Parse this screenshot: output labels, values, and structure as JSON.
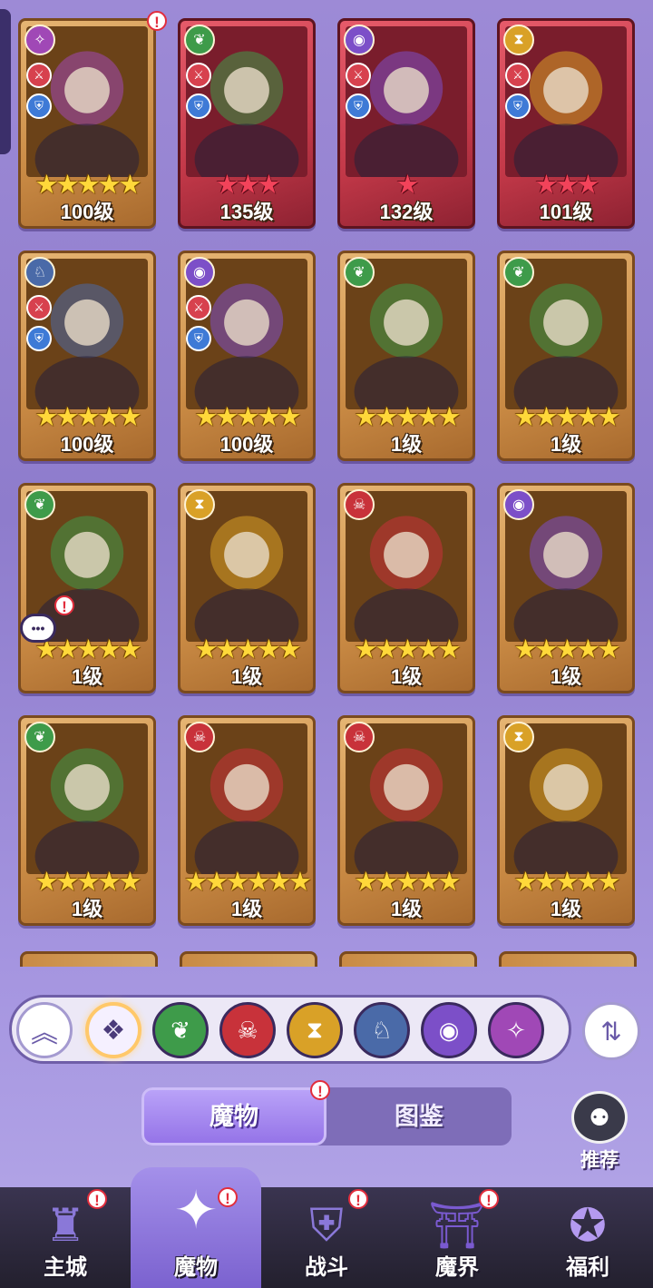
{
  "colors": {
    "forest": "#3e9b4a",
    "demon": "#c8323a",
    "time": "#d9a127",
    "beast": "#4a6aa8",
    "eye": "#7c4fc8",
    "chaos": "#a048b6"
  },
  "cards": [
    {
      "level": "100级",
      "stars": 5,
      "star_color": "gold",
      "frame": "gold",
      "faction": "chaos",
      "faction_icon": "✧",
      "roles": true,
      "alert": true
    },
    {
      "level": "135级",
      "stars": 3,
      "star_color": "red",
      "frame": "red",
      "faction": "forest",
      "faction_icon": "❦",
      "roles": true,
      "alert": false
    },
    {
      "level": "132级",
      "stars": 1,
      "star_color": "red",
      "frame": "red",
      "faction": "eye",
      "faction_icon": "◉",
      "roles": true,
      "alert": false
    },
    {
      "level": "101级",
      "stars": 3,
      "star_color": "red",
      "frame": "red",
      "faction": "time",
      "faction_icon": "⧗",
      "roles": true,
      "alert": false
    },
    {
      "level": "100级",
      "stars": 5,
      "star_color": "gold",
      "frame": "gold",
      "faction": "beast",
      "faction_icon": "♘",
      "roles": true,
      "alert": false
    },
    {
      "level": "100级",
      "stars": 5,
      "star_color": "gold",
      "frame": "gold",
      "faction": "eye",
      "faction_icon": "◉",
      "roles": true,
      "alert": false
    },
    {
      "level": "1级",
      "stars": 5,
      "star_color": "gold",
      "frame": "gold",
      "faction": "forest",
      "faction_icon": "❦",
      "roles": false,
      "alert": false
    },
    {
      "level": "1级",
      "stars": 5,
      "star_color": "gold",
      "frame": "gold",
      "faction": "forest",
      "faction_icon": "❦",
      "roles": false,
      "alert": false
    },
    {
      "level": "1级",
      "stars": 5,
      "star_color": "gold",
      "frame": "gold",
      "faction": "forest",
      "faction_icon": "❦",
      "roles": false,
      "alert": true
    },
    {
      "level": "1级",
      "stars": 5,
      "star_color": "gold",
      "frame": "gold",
      "faction": "time",
      "faction_icon": "⧗",
      "roles": false,
      "alert": false
    },
    {
      "level": "1级",
      "stars": 5,
      "star_color": "gold",
      "frame": "gold",
      "faction": "demon",
      "faction_icon": "☠",
      "roles": false,
      "alert": false
    },
    {
      "level": "1级",
      "stars": 5,
      "star_color": "gold",
      "frame": "gold",
      "faction": "eye",
      "faction_icon": "◉",
      "roles": false,
      "alert": false
    },
    {
      "level": "1级",
      "stars": 5,
      "star_color": "gold",
      "frame": "gold",
      "faction": "forest",
      "faction_icon": "❦",
      "roles": false,
      "alert": false
    },
    {
      "level": "1级",
      "stars": 6,
      "star_color": "gold",
      "frame": "gold",
      "faction": "demon",
      "faction_icon": "☠",
      "roles": false,
      "alert": false
    },
    {
      "level": "1级",
      "stars": 5,
      "star_color": "gold",
      "frame": "gold",
      "faction": "demon",
      "faction_icon": "☠",
      "roles": false,
      "alert": false
    },
    {
      "level": "1级",
      "stars": 5,
      "star_color": "gold",
      "frame": "gold",
      "faction": "time",
      "faction_icon": "⧗",
      "roles": false,
      "alert": false
    }
  ],
  "filters": [
    {
      "name": "collapse",
      "icon": "︽"
    },
    {
      "name": "all",
      "icon": "❖"
    },
    {
      "name": "forest",
      "icon": "❦"
    },
    {
      "name": "demon",
      "icon": "☠"
    },
    {
      "name": "time",
      "icon": "⧗"
    },
    {
      "name": "beast",
      "icon": "♘"
    },
    {
      "name": "eye",
      "icon": "◉"
    },
    {
      "name": "chaos",
      "icon": "✧"
    }
  ],
  "sort_icon": "⇅",
  "tabs": {
    "monsters": "魔物",
    "codex": "图鉴"
  },
  "recommend": "推荐",
  "nav": [
    {
      "label": "主城",
      "icon": "♜",
      "alert": true,
      "active": false
    },
    {
      "label": "魔物",
      "icon": "✦",
      "alert": true,
      "active": true
    },
    {
      "label": "战斗",
      "icon": "⛨",
      "alert": true,
      "active": false
    },
    {
      "label": "魔界",
      "icon": "⛩",
      "alert": true,
      "active": false
    },
    {
      "label": "福利",
      "icon": "✪",
      "alert": false,
      "active": false
    }
  ]
}
